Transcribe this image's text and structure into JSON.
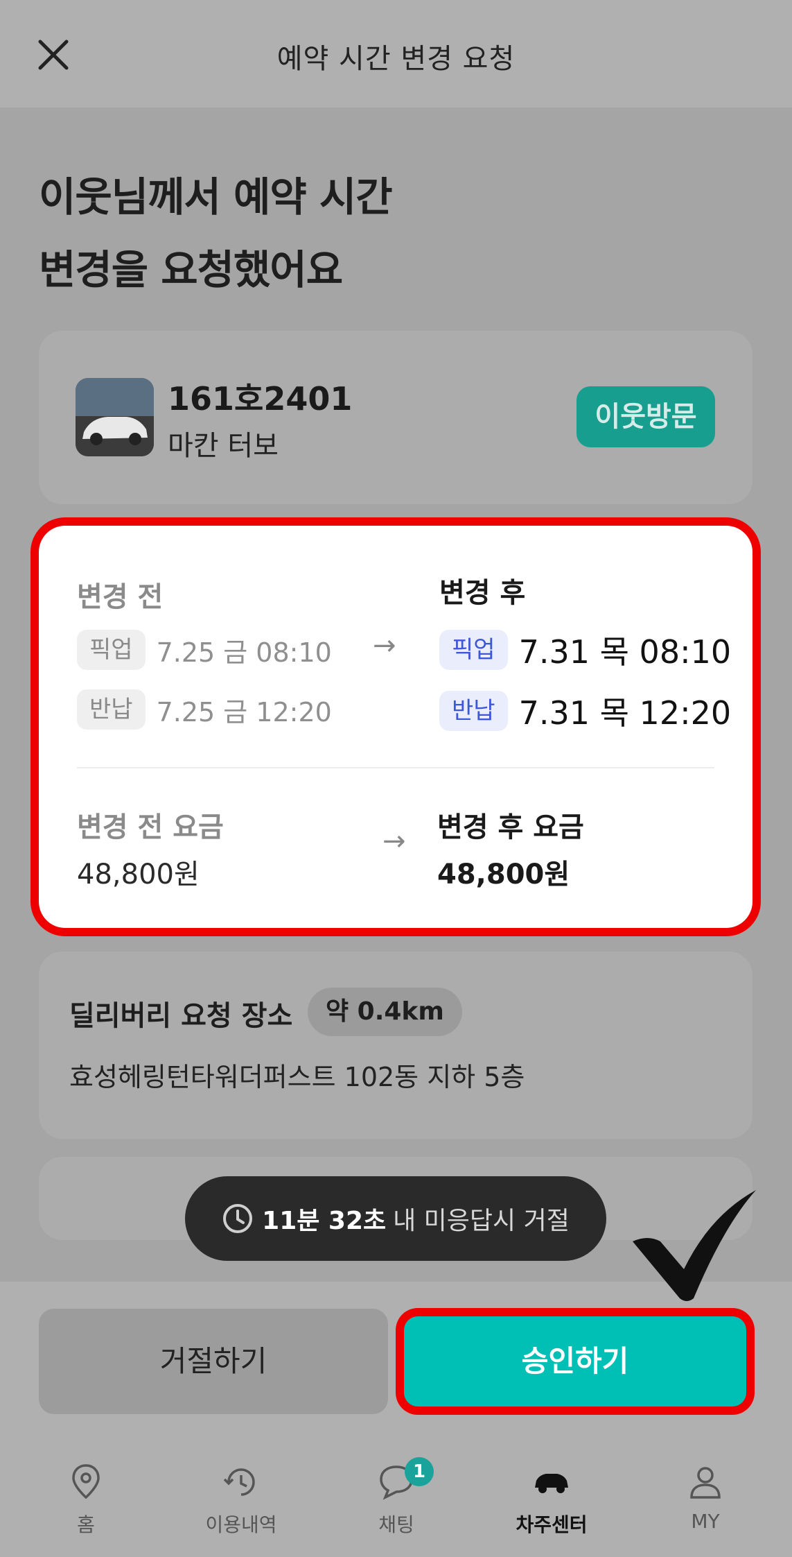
{
  "header": {
    "title": "예약 시간 변경 요청"
  },
  "headline": {
    "line1": "이웃님께서 예약 시간",
    "line2": "변경을 요청했어요"
  },
  "car": {
    "plate": "161호2401",
    "model": "마칸 터보",
    "badge": "이웃방문"
  },
  "change": {
    "before_title": "변경 전",
    "after_title": "변경 후",
    "pickup_label": "픽업",
    "return_label": "반납",
    "before_pickup": "7.25 금 08:10",
    "before_return": "7.25 금 12:20",
    "after_pickup": "7.31 목 08:10",
    "after_return": "7.31 목 12:20",
    "before_fee_title": "변경 전 요금",
    "after_fee_title": "변경 후 요금",
    "before_fee": "48,800원",
    "after_fee": "48,800원",
    "arrow": "→"
  },
  "delivery": {
    "title": "딜리버리 요청 장소",
    "distance": "약 0.4km",
    "address": "효성헤링턴타워더퍼스트 102동 지하 5층"
  },
  "toast": {
    "time": "11분 32초",
    "text": "내 미응답시 거절"
  },
  "actions": {
    "reject": "거절하기",
    "approve": "승인하기"
  },
  "nav": {
    "home": "홈",
    "history": "이용내역",
    "chat": "채팅",
    "chat_badge": "1",
    "owner_center": "차주센터",
    "my": "MY"
  },
  "colors": {
    "accent": "#00bfb4",
    "highlight": "#ee0000",
    "badge_teal": "#189e8f",
    "pill_blue": "#3d58d6"
  }
}
